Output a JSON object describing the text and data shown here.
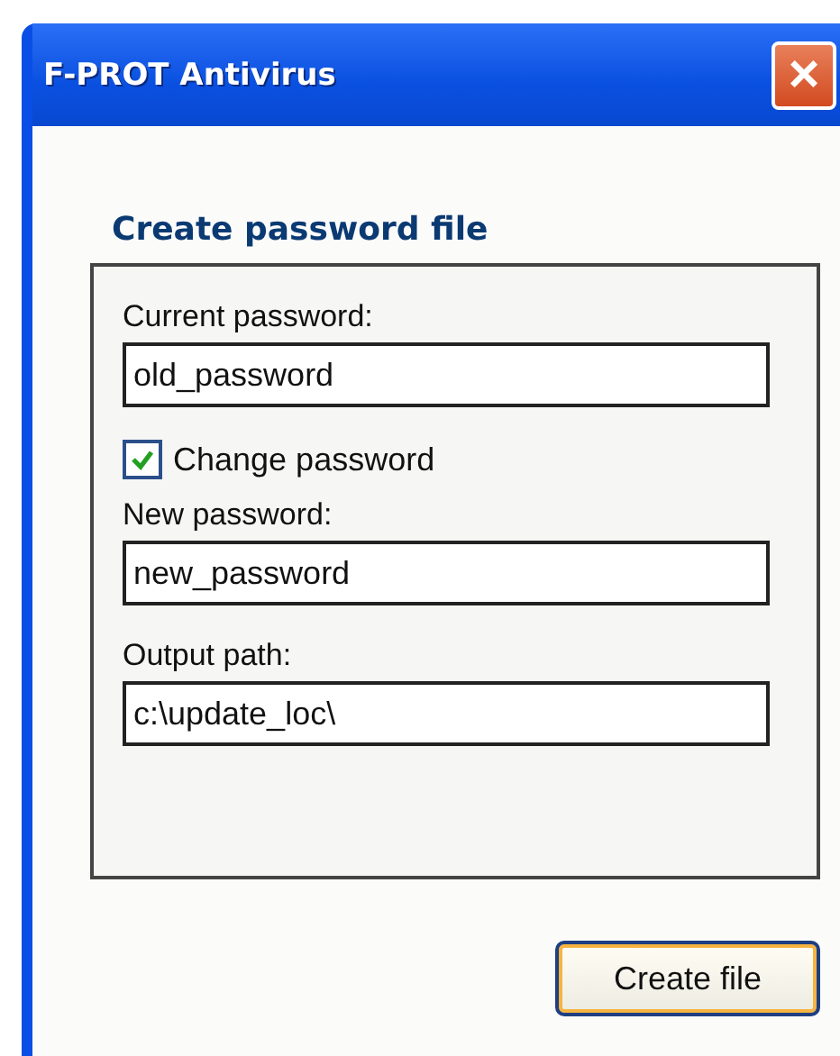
{
  "window": {
    "title": "F-PROT Antivirus",
    "close": "×"
  },
  "heading": "Create password file",
  "fields": [
    {
      "kind": "field",
      "label": "Current password:",
      "value": "old_password"
    },
    {
      "kind": "checkbox",
      "label": "Change password",
      "checked": true
    },
    {
      "kind": "field",
      "label": "New password:",
      "value": "new_password"
    },
    {
      "kind": "field",
      "label": "Output path:",
      "value": "c:\\update_loc\\"
    }
  ],
  "button": "Create file"
}
